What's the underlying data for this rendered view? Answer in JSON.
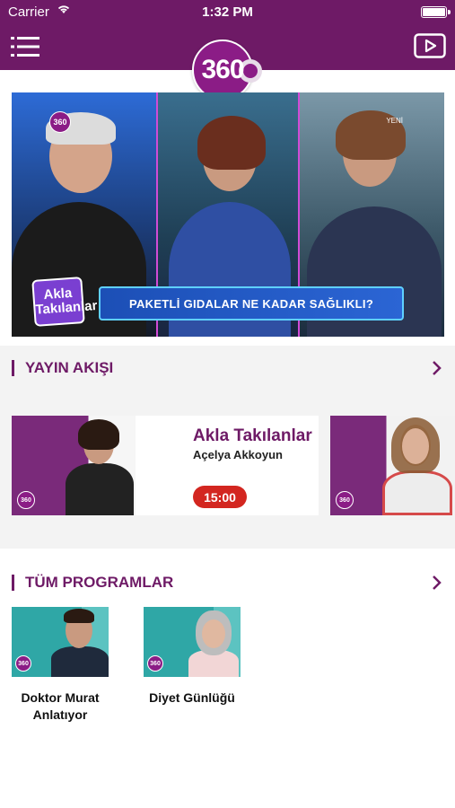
{
  "status_bar": {
    "carrier": "Carrier",
    "time": "1:32 PM"
  },
  "nav": {
    "logo_text": "360"
  },
  "hero": {
    "caption": "PAKETLİ GIDALAR NE KADAR SAĞLIKLI?",
    "show_logo": "Akla Takılanlar",
    "channel_badge": "360",
    "corner_text": "YENİ"
  },
  "schedule": {
    "title": "YAYIN AKIŞI",
    "items": [
      {
        "title": "Akla Takılanlar",
        "host": "Açelya  Akkoyun",
        "time": "15:00",
        "badge": "360"
      },
      {
        "badge": "360"
      }
    ]
  },
  "programs": {
    "title": "TÜM PROGRAMLAR",
    "items": [
      {
        "name": "Doktor Murat Anlatıyor",
        "badge": "360"
      },
      {
        "name": "Diyet  Günlüğü",
        "badge": "360"
      }
    ]
  },
  "colors": {
    "brand": "#6e1a66",
    "accent_red": "#d32620",
    "logo": "#8b1c86"
  },
  "icons": [
    "hamburger-menu-icon",
    "play-video-icon",
    "wifi-icon",
    "battery-icon",
    "chevron-right-icon"
  ]
}
